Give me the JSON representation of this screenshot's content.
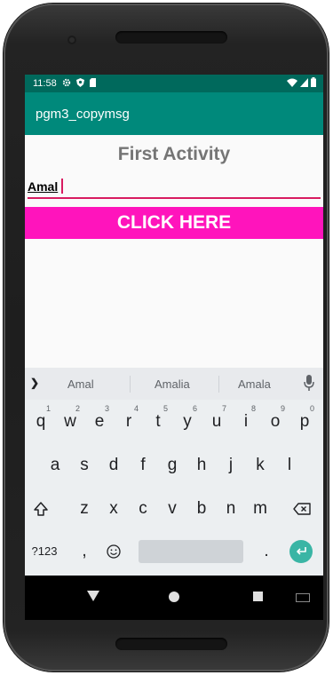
{
  "status_bar": {
    "time": "11:58",
    "icons": [
      "settings-icon",
      "shield-icon",
      "sd-card-icon",
      "wifi-icon",
      "signal-icon",
      "battery-icon"
    ]
  },
  "app": {
    "title": "pgm3_copymsg",
    "heading": "First Activity",
    "input_value": "Amal",
    "button_label": "CLICK HERE",
    "colors": {
      "status_bar": "#00695c",
      "app_bar": "#00897b",
      "button": "#ff14bc",
      "input_underline": "#d81b60",
      "heading": "#757575"
    }
  },
  "keyboard": {
    "suggestions": [
      "Amal",
      "Amalia",
      "Amala"
    ],
    "row1": [
      {
        "k": "q",
        "n": "1"
      },
      {
        "k": "w",
        "n": "2"
      },
      {
        "k": "e",
        "n": "3"
      },
      {
        "k": "r",
        "n": "4"
      },
      {
        "k": "t",
        "n": "5"
      },
      {
        "k": "y",
        "n": "6"
      },
      {
        "k": "u",
        "n": "7"
      },
      {
        "k": "i",
        "n": "8"
      },
      {
        "k": "o",
        "n": "9"
      },
      {
        "k": "p",
        "n": "0"
      }
    ],
    "row2": [
      "a",
      "s",
      "d",
      "f",
      "g",
      "h",
      "j",
      "k",
      "l"
    ],
    "row3": [
      "z",
      "x",
      "c",
      "v",
      "b",
      "n",
      "m"
    ],
    "symbols_key": "?123",
    "comma_key": ",",
    "period_key": "."
  },
  "nav_bar": {
    "icons": [
      "back-icon",
      "home-icon",
      "recents-icon",
      "keyboard-switch-icon"
    ]
  }
}
